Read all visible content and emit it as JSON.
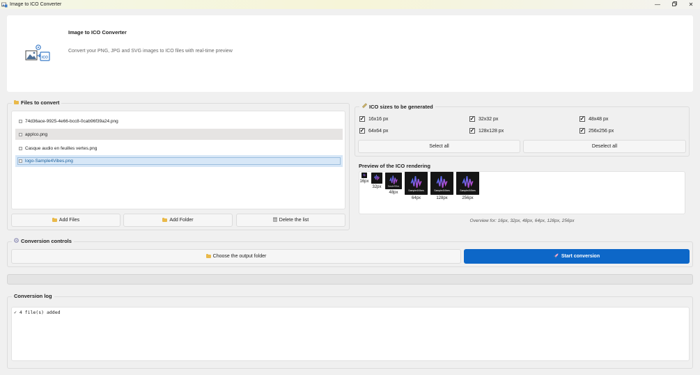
{
  "window": {
    "title": "Image to ICO Converter"
  },
  "header": {
    "title": "Image to ICO Converter",
    "subtitle": "Convert your PNG, JPG and SVG images to ICO files with real-time preview",
    "logo_text": "ICO"
  },
  "files": {
    "group_label": "Files to convert",
    "items": [
      {
        "name": "74d36ace-9925-4e66-bcc8-0cab96f39a24.png",
        "state": "normal"
      },
      {
        "name": "appIco.png",
        "state": "hover"
      },
      {
        "name": "Casque audio en feuilles vertes.png",
        "state": "normal"
      },
      {
        "name": "logo-Sample4Vibes.png",
        "state": "selected"
      }
    ],
    "add_files_label": "Add Files",
    "add_folder_label": "Add Folder",
    "delete_list_label": "Delete the list"
  },
  "sizes": {
    "group_label": "ICO sizes to be generated",
    "options": [
      {
        "label": "16x16 px",
        "checked": true
      },
      {
        "label": "32x32 px",
        "checked": true
      },
      {
        "label": "48x48 px",
        "checked": true
      },
      {
        "label": "64x64 px",
        "checked": true
      },
      {
        "label": "128x128 px",
        "checked": true
      },
      {
        "label": "256x256 px",
        "checked": true
      }
    ],
    "select_all_label": "Select all",
    "deselect_all_label": "Deselect all"
  },
  "preview": {
    "title": "Preview of the ICO rendering",
    "logo_caption": "Sample4Vibes",
    "items": [
      {
        "label": "16px"
      },
      {
        "label": "32px"
      },
      {
        "label": "48px"
      },
      {
        "label": "64px"
      },
      {
        "label": "128px"
      },
      {
        "label": "256px"
      }
    ],
    "overview": "Overview for: 16px, 32px, 48px, 64px, 128px, 256px"
  },
  "controls": {
    "group_label": "Conversion controls",
    "output_folder_label": "Choose the output folder",
    "start_label": "Start conversion"
  },
  "progress": {
    "value": 0
  },
  "log": {
    "group_label": "Conversion log",
    "lines": [
      "✓ 4 file(s) added"
    ]
  },
  "colors": {
    "accent": "#0d67c8",
    "selection": "#d7e7f7",
    "folder": "#e9b94a"
  }
}
